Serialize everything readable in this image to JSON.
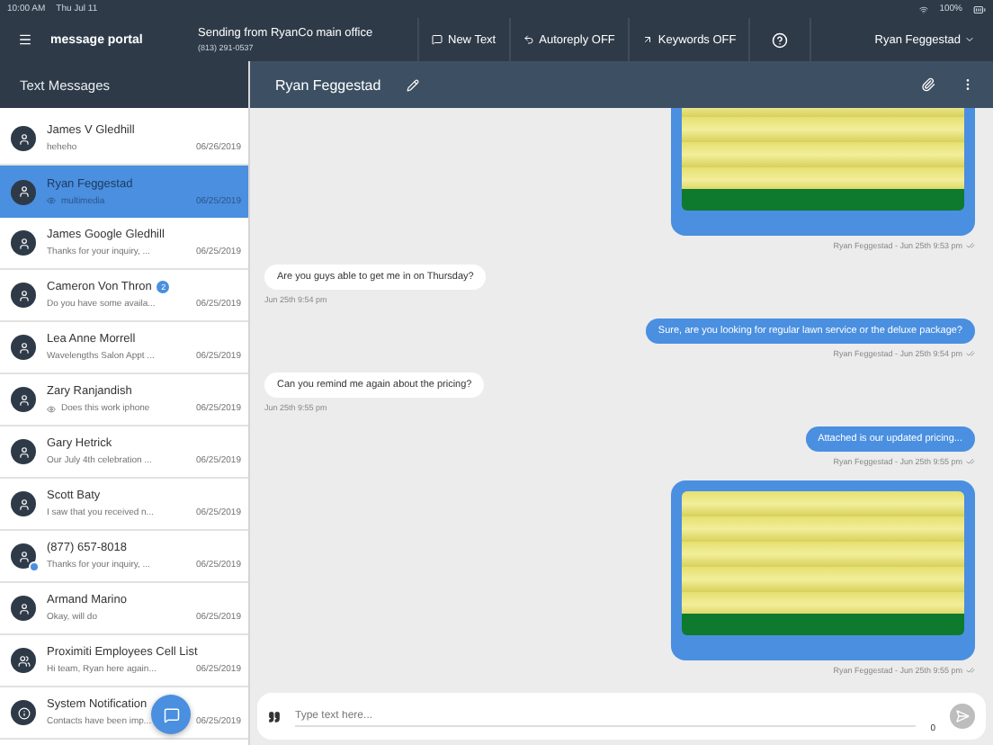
{
  "status_bar": {
    "time": "10:00 AM",
    "date": "Thu Jul 11",
    "battery": "100%"
  },
  "top_bar": {
    "brand": "message portal",
    "sender": {
      "title": "Sending from RyanCo main office",
      "phone": "(813) 291-0537"
    },
    "actions": [
      {
        "kind": "new",
        "label": "New Text"
      },
      {
        "kind": "autoreply",
        "label": "Autoreply OFF"
      },
      {
        "kind": "keywords",
        "label": "Keywords OFF"
      }
    ],
    "user": "Ryan Feggestad"
  },
  "sidebar": {
    "title": "Text Messages",
    "conversations": [
      {
        "name": "James V Gledhill",
        "preview": "heheho",
        "date": "06/26/2019",
        "selected": false,
        "kind": "person",
        "marked": false,
        "preview_icon": false
      },
      {
        "name": "Ryan Feggestad",
        "preview": "multimedia",
        "date": "06/25/2019",
        "selected": true,
        "kind": "person",
        "marked": false,
        "preview_icon": true
      },
      {
        "name": "James Google Gledhill",
        "preview": "Thanks for your inquiry, ...",
        "date": "06/25/2019",
        "selected": false,
        "kind": "person",
        "marked": false,
        "preview_icon": false
      },
      {
        "name": "Cameron Von Thron",
        "badge": "2",
        "preview": "Do you have some availa...",
        "date": "06/25/2019",
        "selected": false,
        "kind": "person",
        "marked": false,
        "preview_icon": false
      },
      {
        "name": "Lea Anne Morrell",
        "preview": "Wavelengths Salon Appt ...",
        "date": "06/25/2019",
        "selected": false,
        "kind": "person",
        "marked": false,
        "preview_icon": false
      },
      {
        "name": "Zary Ranjandish",
        "preview": "Does this work iphone",
        "date": "06/25/2019",
        "selected": false,
        "kind": "person",
        "marked": false,
        "preview_icon": true
      },
      {
        "name": "Gary Hetrick",
        "preview": "Our July 4th celebration ...",
        "date": "06/25/2019",
        "selected": false,
        "kind": "person",
        "marked": false,
        "preview_icon": false
      },
      {
        "name": "Scott Baty",
        "preview": "I saw that you received n...",
        "date": "06/25/2019",
        "selected": false,
        "kind": "person",
        "marked": false,
        "preview_icon": false
      },
      {
        "name": "(877) 657-8018",
        "preview": "Thanks for your inquiry, ...",
        "date": "06/25/2019",
        "selected": false,
        "kind": "person",
        "marked": true,
        "preview_icon": false
      },
      {
        "name": "Armand Marino",
        "preview": "Okay, will do",
        "date": "06/25/2019",
        "selected": false,
        "kind": "person",
        "marked": false,
        "preview_icon": false
      },
      {
        "name": "Proximiti Employees Cell List",
        "preview": "Hi team, Ryan here again...",
        "date": "06/25/2019",
        "selected": false,
        "kind": "group",
        "marked": false,
        "preview_icon": false
      },
      {
        "name": "System Notification",
        "preview": "Contacts have been imp...",
        "date": "06/25/2019",
        "selected": false,
        "kind": "info",
        "marked": false,
        "preview_icon": false
      }
    ]
  },
  "chat": {
    "contact": "Ryan Feggestad",
    "messages": [
      {
        "kind": "image",
        "outgoing": true,
        "meta": "Ryan Feggestad - Jun 25th 9:53 pm"
      },
      {
        "kind": "text",
        "outgoing": false,
        "text": "Are you guys able to get me in on Thursday?",
        "meta": "Jun 25th 9:54 pm"
      },
      {
        "kind": "text",
        "outgoing": true,
        "text": "Sure, are you looking for regular lawn service or the deluxe package?",
        "meta": "Ryan Feggestad - Jun 25th 9:54 pm"
      },
      {
        "kind": "text",
        "outgoing": false,
        "text": "Can you remind me again about the pricing?",
        "meta": "Jun 25th 9:55 pm"
      },
      {
        "kind": "text",
        "outgoing": true,
        "text": "Attached is our updated pricing...",
        "meta": "Ryan Feggestad - Jun 25th 9:55 pm"
      },
      {
        "kind": "image",
        "outgoing": true,
        "meta": "Ryan Feggestad - Jun 25th 9:55 pm"
      }
    ],
    "composer": {
      "placeholder": "Type text here...",
      "counter": "0"
    }
  }
}
